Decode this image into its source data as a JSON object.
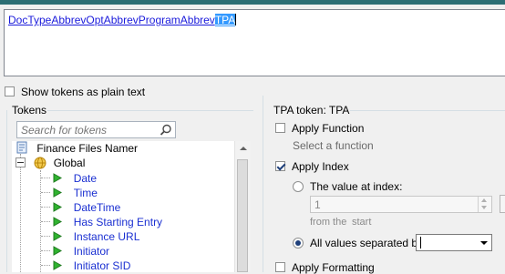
{
  "formula": {
    "tokens": [
      "DocType",
      "Abbrev",
      "Opt",
      "Abbrev",
      "Program",
      "Abbrev"
    ],
    "selected_token": "TPA"
  },
  "show_plain": {
    "label": "Show tokens as plain text",
    "checked": false
  },
  "tokens_panel": {
    "title": "Tokens",
    "search_placeholder": "Search for tokens",
    "root_label": "Finance Files Namer",
    "group_label": "Global",
    "items": [
      "Date",
      "Time",
      "DateTime",
      "Has Starting Entry",
      "Instance URL",
      "Initiator",
      "Initiator SID"
    ]
  },
  "token_panel": {
    "title": "TPA token: TPA",
    "apply_function": {
      "label": "Apply Function",
      "checked": false
    },
    "function_hint": "Select a function",
    "apply_index": {
      "label": "Apply Index",
      "checked": true
    },
    "value_at_index": {
      "label": "The value at index:",
      "value": "1",
      "selected": false
    },
    "from_the": "from the",
    "start": "start",
    "all_values": {
      "label": "All values separated by:",
      "selected": true,
      "value": ""
    },
    "apply_formatting": {
      "label": "Apply Formatting",
      "checked": false
    }
  },
  "colors": {
    "accent": "#2c6e74",
    "token_link": "#1a1adb",
    "selection": "#3399ff"
  }
}
